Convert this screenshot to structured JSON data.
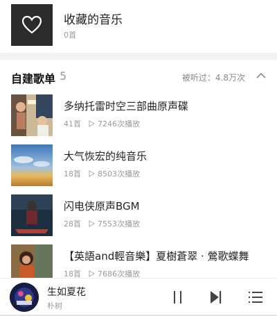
{
  "favorites": {
    "title": "收藏的音乐",
    "count": "0首",
    "icon": "heart-icon"
  },
  "section": {
    "title": "自建歌单",
    "count": "5",
    "listened": "被听过：4.8万次",
    "collapse_icon": "chevron-up-icon"
  },
  "playlists": [
    {
      "title": "多纳托雷时空三部曲原声碟",
      "tracks": "41首",
      "plays": "7246次播放"
    },
    {
      "title": "大气恢宏的纯音乐",
      "tracks": "18首",
      "plays": "8503次播放"
    },
    {
      "title": "闪电侠原声BGM",
      "tracks": "28首",
      "plays": "7553次播放"
    },
    {
      "title": "【英語and輕音樂】夏樹蒼翠 · 鶯歌蝶舞",
      "tracks": "18首",
      "plays": "7686次播放"
    }
  ],
  "player": {
    "song": "生如夏花",
    "artist": "朴树",
    "icons": [
      "pause-icon",
      "next-icon",
      "playlist-icon"
    ]
  },
  "colors": {
    "accent_red": "#d43c33",
    "secondary_text": "#999999",
    "divider_bg": "#f2f2f2"
  }
}
